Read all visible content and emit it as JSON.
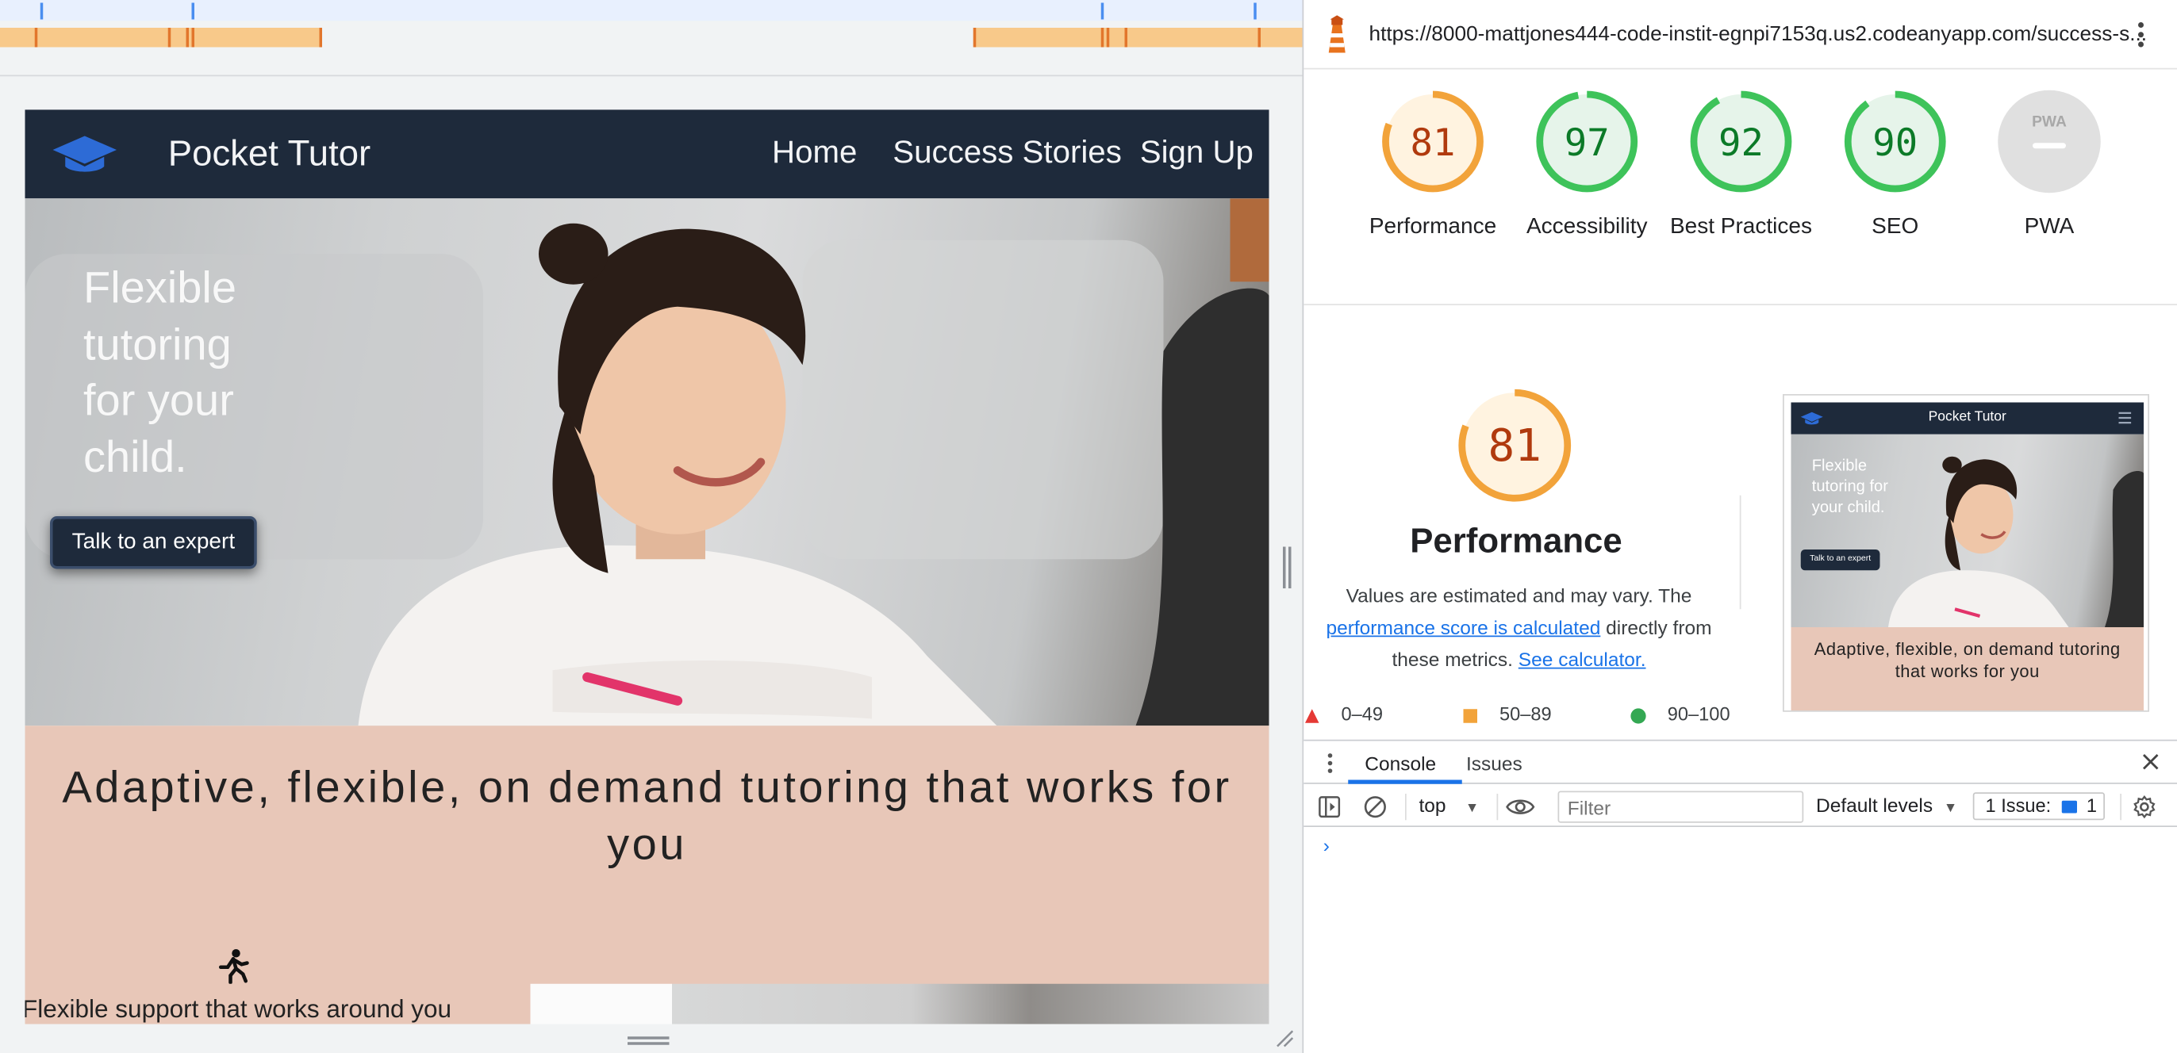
{
  "site": {
    "brand": "Pocket Tutor",
    "nav": [
      "Home",
      "Success Stories",
      "Sign Up"
    ],
    "hero_heading": "Flexible tutoring for your child.",
    "cta_label": "Talk to an expert",
    "tagline": "Adaptive, flexible, on demand tutoring that works for you",
    "feature_text": "Flexible support that works around you",
    "colors": {
      "nav_bg": "#1e2a3b",
      "band_bg": "#e8c7b8"
    }
  },
  "lighthouse": {
    "url": "https://8000-mattjones444-code-instit-egnpi7153q.us2.codeanyapp.com/success-s...",
    "scores": [
      {
        "label": "Performance",
        "value": "81",
        "color": "#e67700",
        "fill": "#fff3e0",
        "fraction": 0.81
      },
      {
        "label": "Accessibility",
        "value": "97",
        "color": "#0c8a2c",
        "fill": "#e6f4ea",
        "fraction": 0.97
      },
      {
        "label": "Best Practices",
        "value": "92",
        "color": "#0c8a2c",
        "fill": "#e6f4ea",
        "fraction": 0.92
      },
      {
        "label": "SEO",
        "value": "90",
        "color": "#0c8a2c",
        "fill": "#e6f4ea",
        "fraction": 0.9
      },
      {
        "label": "PWA",
        "value": "PWA",
        "color": "#9e9e9e",
        "fill": "#e0e0e0"
      }
    ],
    "performance": {
      "score": "81",
      "title": "Performance",
      "desc_prefix": "Values are estimated and may vary. The",
      "link_calc": "performance score is calculated",
      "desc_mid": "directly from these metrics.",
      "link_see": "See calculator."
    },
    "legend": [
      "0–49",
      "50–89",
      "90–100"
    ],
    "thumbnail": {
      "brand": "Pocket Tutor",
      "hero_heading": "Flexible tutoring for your child.",
      "cta_label": "Talk to an expert",
      "tagline": "Adaptive, flexible, on demand tutoring that works for you"
    }
  },
  "console": {
    "tabs": [
      "Console",
      "Issues"
    ],
    "context": "top",
    "filter_placeholder": "Filter",
    "levels": "Default levels",
    "issues_label": "1 Issue:",
    "issues_count": "1",
    "prompt": "›"
  }
}
